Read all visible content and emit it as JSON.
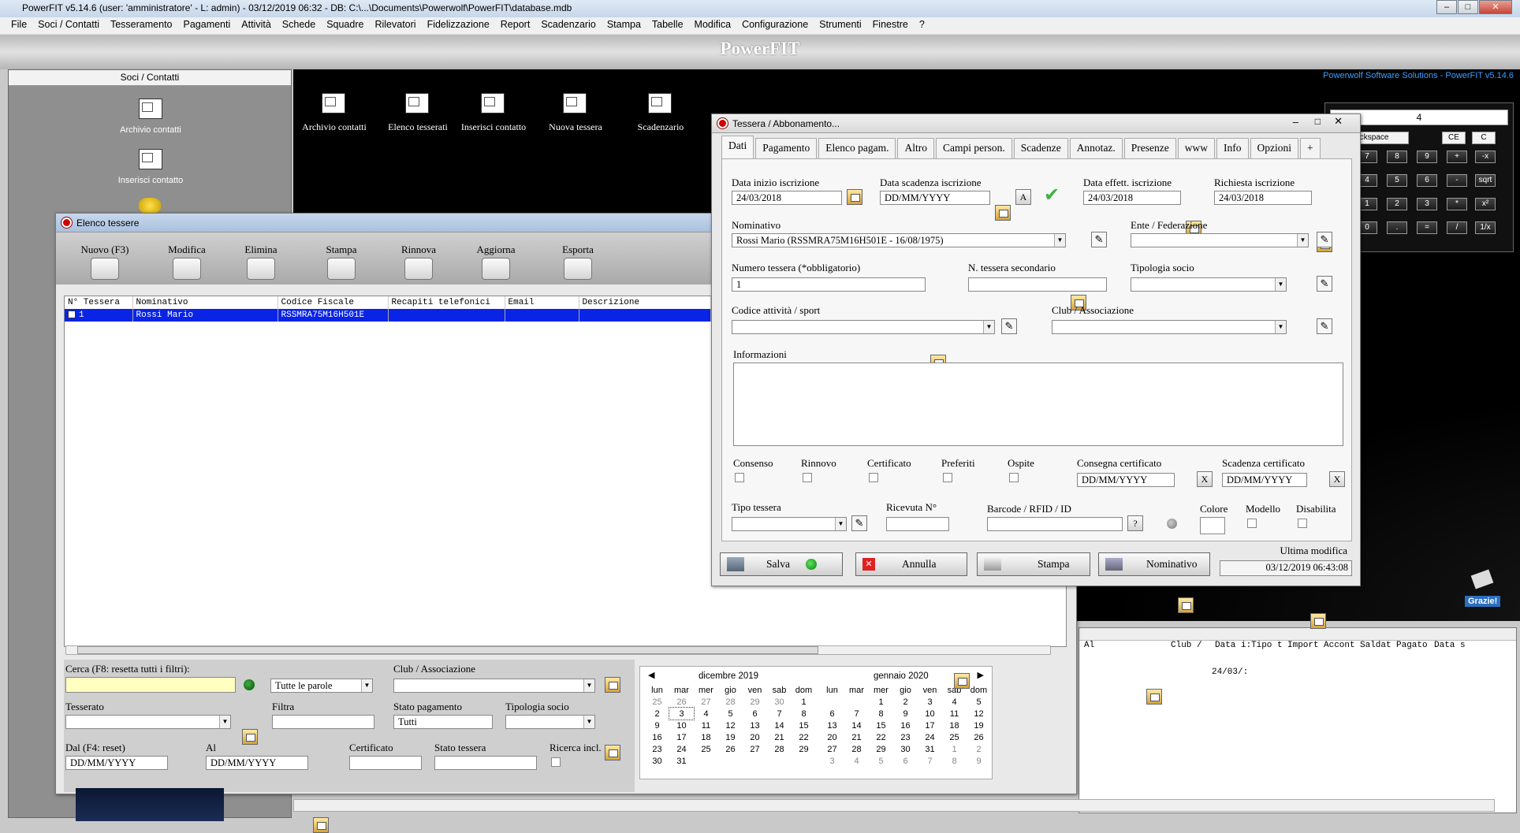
{
  "titlebar": {
    "text": "PowerFIT v5.14.6  (user: 'amministratore'  - L: admin) - 03/12/2019 06:32 - DB: C:\\...\\Documents\\Powerwolf\\PowerFIT\\database.mdb"
  },
  "menu": [
    "File",
    "Soci / Contatti",
    "Tesseramento",
    "Pagamenti",
    "Attività",
    "Schede",
    "Squadre",
    "Rilevatori",
    "Fidelizzazione",
    "Report",
    "Scadenzario",
    "Stampa",
    "Tabelle",
    "Modifica",
    "Configurazione",
    "Strumenti",
    "Finestre",
    "?"
  ],
  "banner": "PowerFIT",
  "brand": "Powerwolf Software Solutions - PowerFIT v5.14.6",
  "left_panel": {
    "header": "Soci / Contatti",
    "items": [
      "Archivio contatti",
      "Inserisci contatto"
    ]
  },
  "toolbar": [
    "Archivio contatti",
    "Elenco tesserati",
    "Inserisci contatto",
    "Nuova tessera",
    "Scadenzario"
  ],
  "elenco": {
    "title": "Elenco tessere",
    "buttons": [
      "Nuovo (F3)",
      "Modifica",
      "Elimina",
      "Stampa",
      "Rinnova",
      "Aggiorna",
      "Esporta"
    ],
    "columns": [
      "N° Tessera",
      "Nominativo",
      "Codice Fiscale",
      "Recapiti telefonici",
      "Email",
      "Descrizione"
    ],
    "row": {
      "n": "1",
      "nominativo": "Rossi Mario",
      "cf": "RSSMRA75M16H501E"
    },
    "filters": {
      "cerca": "Cerca (F8: resetta tutti i filtri):",
      "parole": "Tutte le parole",
      "club": "Club / Associazione",
      "tesserato": "Tesserato",
      "filtra": "Filtra",
      "stato_pag": "Stato pagamento",
      "stato_pag_val": "Tutti",
      "tipologia": "Tipologia socio",
      "dal": "Dal (F4: reset)",
      "al": "Al",
      "certificato": "Certificato",
      "stato_tessera": "Stato tessera",
      "ricerca": "Ricerca incl.",
      "date_ph": "DD/MM/YYYY"
    },
    "cal1": {
      "title": "dicembre 2019"
    },
    "cal2": {
      "title": "gennaio 2020"
    },
    "days": [
      "lun",
      "mar",
      "mer",
      "gio",
      "ven",
      "sab",
      "dom"
    ]
  },
  "right_grid": {
    "columns": [
      "Al",
      "Club /",
      "Data i:",
      "Tipo t",
      "Import",
      "Accont",
      "Saldat",
      "Pagato",
      "Data s"
    ],
    "cell": "24/03/:"
  },
  "calc": {
    "display": "4",
    "keys": [
      "Backspace",
      "CE",
      "C",
      "7",
      "8",
      "9",
      "+",
      "-x",
      "4",
      "5",
      "6",
      "-",
      "sqrt",
      "1",
      "2",
      "3",
      "*",
      "x²",
      "0",
      ".",
      "=",
      "/",
      "1/x"
    ],
    "thanks": "Grazie!"
  },
  "tessera": {
    "title": "Tessera / Abbonamento...",
    "tabs": [
      "Dati",
      "Pagamento",
      "Elenco pagam.",
      "Altro",
      "Campi person.",
      "Scadenze",
      "Annotaz.",
      "Presenze",
      "www",
      "Info",
      "Opzioni",
      "+"
    ],
    "data_inizio_lbl": "Data inizio iscrizione",
    "data_inizio": "24/03/2018",
    "data_scad_lbl": "Data scadenza iscrizione",
    "data_scad": "DD/MM/YYYY",
    "a_btn": "A",
    "data_eff_lbl": "Data effett. iscrizione",
    "data_eff": "24/03/2018",
    "richiesta_lbl": "Richiesta iscrizione",
    "richiesta": "24/03/2018",
    "nominativo_lbl": "Nominativo",
    "nominativo": "Rossi Mario (RSSMRA75M16H501E - 16/08/1975)",
    "ente_lbl": "Ente / Federazione",
    "numero_lbl": "Numero tessera (*obbligatorio)",
    "numero": "1",
    "secondario_lbl": "N. tessera secondario",
    "tipologia_lbl": "Tipologia socio",
    "codice_lbl": "Codice attività / sport",
    "club_lbl": "Club / Associazione",
    "info_lbl": "Informazioni",
    "checks": [
      "Consenso",
      "Rinnovo",
      "Certificato",
      "Preferiti",
      "Ospite"
    ],
    "consegna_lbl": "Consegna certificato",
    "scad_cert_lbl": "Scadenza certificato",
    "date_ph": "DD/MM/YYYY",
    "tipo_lbl": "Tipo tessera",
    "ricevuta_lbl": "Ricevuta N°",
    "barcode_lbl": "Barcode / RFID / ID",
    "q": "?",
    "colore_lbl": "Colore",
    "modello_lbl": "Modello",
    "disabilita_lbl": "Disabilita",
    "ultima_lbl": "Ultima modifica",
    "ultima": "03/12/2019 06:43:08",
    "buttons": {
      "salva": "Salva",
      "annulla": "Annulla",
      "stampa": "Stampa",
      "nominativo": "Nominativo"
    }
  }
}
